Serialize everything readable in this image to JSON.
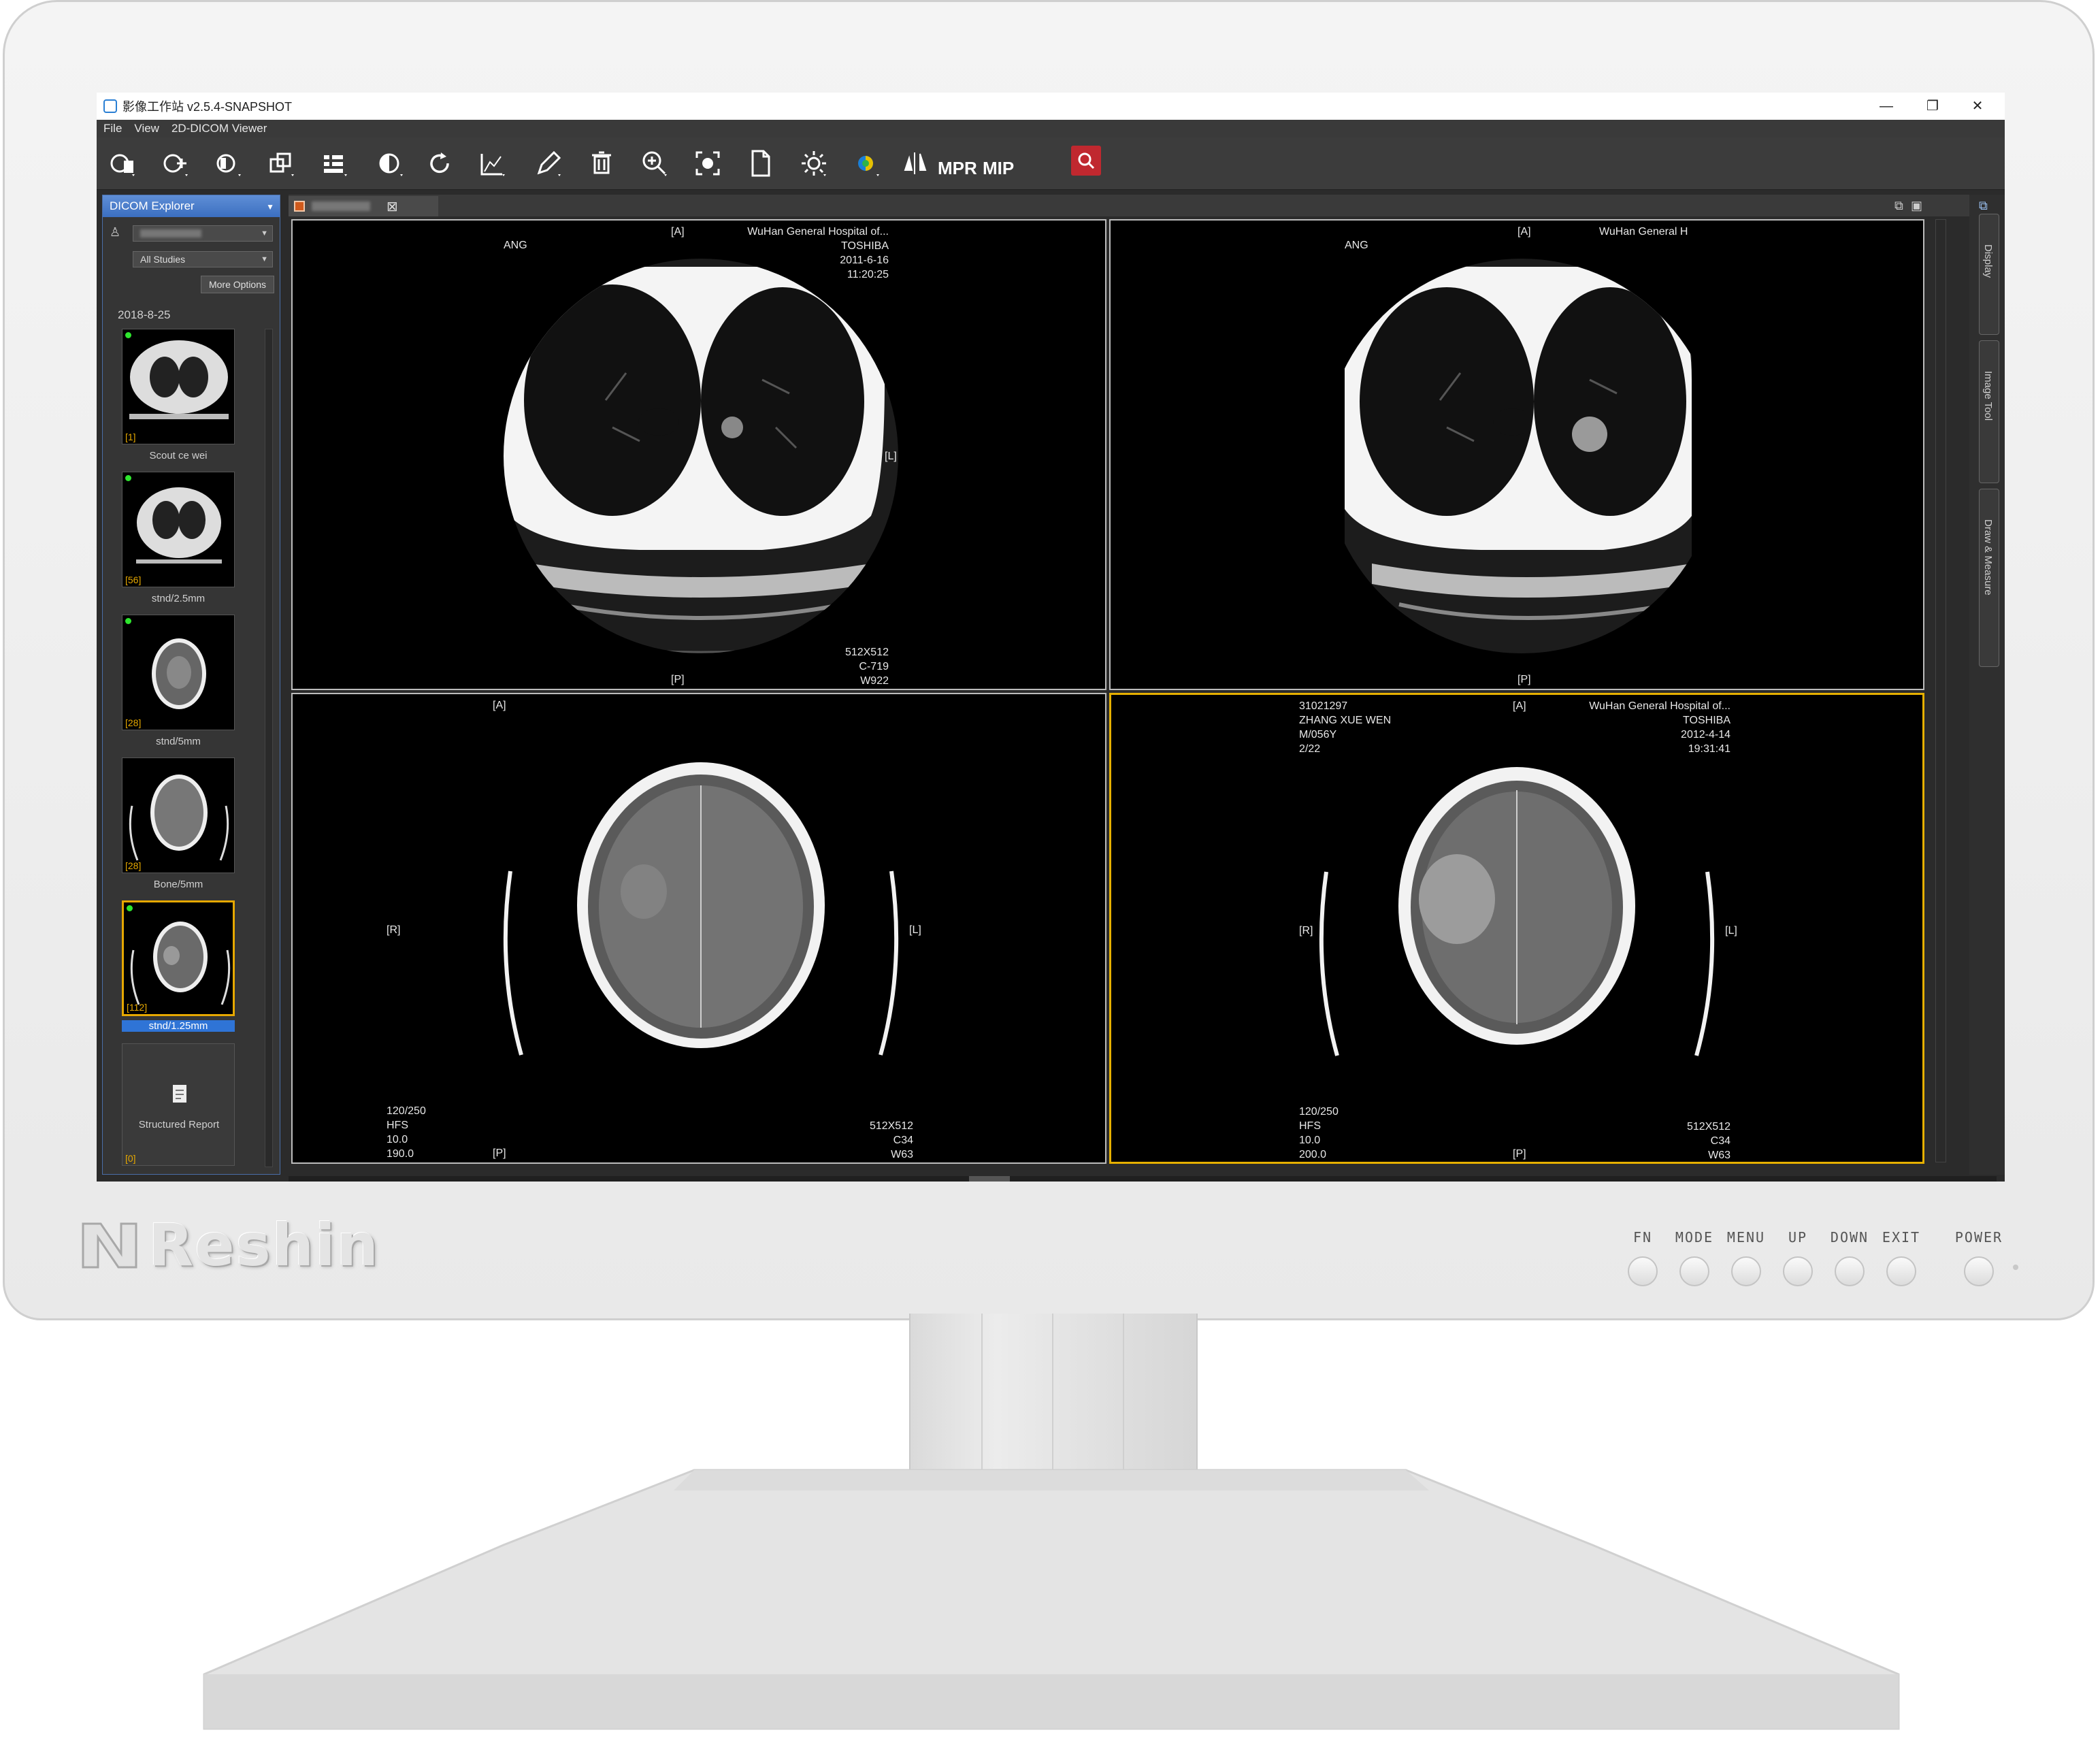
{
  "window": {
    "title": "影像工作站 v2.5.4-SNAPSHOT",
    "minimize_icon": "—",
    "maximize_icon": "❐",
    "close_icon": "✕"
  },
  "menu": [
    "File",
    "View",
    "2D-DICOM Viewer"
  ],
  "toolbar": {
    "mpr_label": "MPR",
    "mip_label": "MIP",
    "search_icon": "search-icon"
  },
  "explorer": {
    "title": "DICOM Explorer",
    "study_filter": "All Studies",
    "more_options": "More Options",
    "study_date": "2018-8-25",
    "series": [
      {
        "count": "[1]",
        "label": "Scout ce wei"
      },
      {
        "count": "[56]",
        "label": "stnd/2.5mm"
      },
      {
        "count": "[28]",
        "label": "stnd/5mm"
      },
      {
        "count": "[28]",
        "label": "Bone/5mm"
      },
      {
        "count": "[112]",
        "label": "stnd/1.25mm",
        "selected": true
      }
    ],
    "structured_report": {
      "label": "Structured Report",
      "count": "[0]"
    }
  },
  "viewports": [
    {
      "top": "[A]",
      "bottom": "[P]",
      "right_marker": "[L]",
      "top_left": "ANG",
      "top_right": [
        "WuHan General Hospital of...",
        "TOSHIBA",
        "2011-6-16",
        "11:20:25"
      ],
      "bottom_right": [
        "512X512",
        "C-719",
        "W922"
      ]
    },
    {
      "top": "[A]",
      "bottom": "[P]",
      "top_left": "ANG",
      "top_right": [
        "WuHan General H"
      ]
    },
    {
      "top": "[A]",
      "bottom": "[P]",
      "left_marker": "[R]",
      "right_marker": "[L]",
      "bottom_left": [
        "120/250",
        "HFS",
        "10.0",
        "190.0"
      ],
      "bottom_right": [
        "512X512",
        "C34",
        "W63"
      ]
    },
    {
      "top": "[A]",
      "bottom": "[P]",
      "left_marker": "[R]",
      "right_marker": "[L]",
      "top_left": [
        "31021297",
        "ZHANG XUE WEN",
        "M/056Y",
        "2/22"
      ],
      "top_right": [
        "WuHan General Hospital of...",
        "TOSHIBA",
        "2012-4-14",
        "19:31:41"
      ],
      "bottom_left": [
        "120/250",
        "HFS",
        "10.0",
        "200.0"
      ],
      "bottom_right": [
        "512X512",
        "C34",
        "W63"
      ]
    }
  ],
  "right_panel": [
    "Display",
    "Image Tool",
    "Draw & Measure"
  ],
  "monitor": {
    "brand": "Reshin",
    "buttons": [
      "FN",
      "MODE",
      "MENU",
      "UP",
      "DOWN",
      "EXIT",
      "POWER"
    ]
  },
  "colors": {
    "accent_blue": "#3b6fc0",
    "active_viewport": "#e6b000",
    "search_red": "#c0282f",
    "status_dot": "#2ee62e"
  }
}
